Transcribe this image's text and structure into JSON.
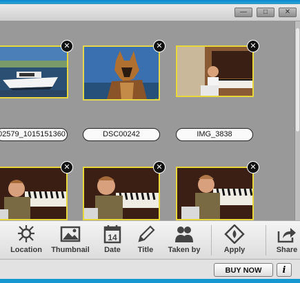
{
  "window": {
    "minimize_glyph": "—",
    "maximize_glyph": "□",
    "close_glyph": "✕"
  },
  "photos": [
    {
      "name": "02579_1015151360",
      "scene": "boat"
    },
    {
      "name": "DSC00242",
      "scene": "dog"
    },
    {
      "name": "IMG_3838",
      "scene": "piano-child"
    },
    {
      "name": "",
      "scene": "piano-child"
    },
    {
      "name": "",
      "scene": "piano-child"
    },
    {
      "name": "",
      "scene": "piano-child"
    }
  ],
  "delete_glyph": "✕",
  "toolbar": {
    "location": "Location",
    "thumbnail": "Thumbnail",
    "date": "Date",
    "date_icon_number": "14",
    "title": "Title",
    "taken_by": "Taken by",
    "apply": "Apply",
    "share": "Share"
  },
  "statusbar": {
    "buy_now": "BUY NOW",
    "info": "i"
  },
  "colors": {
    "selection_border": "#e8d83a",
    "content_bg": "#999999",
    "desktop": "#1aa0d8"
  }
}
